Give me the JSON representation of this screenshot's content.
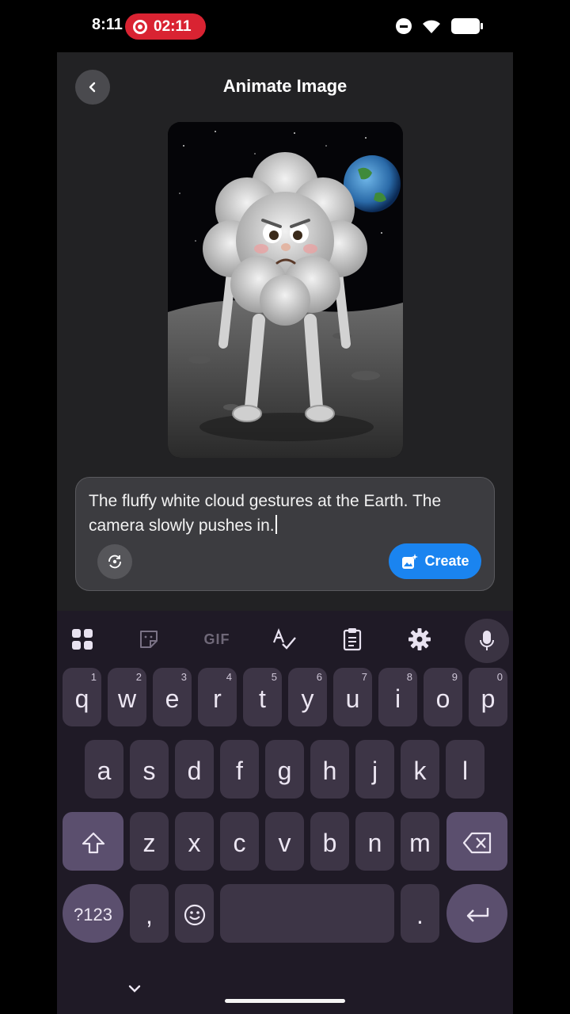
{
  "status_bar": {
    "time": "8:11",
    "recording_time": "02:11"
  },
  "header": {
    "title": "Animate Image"
  },
  "prompt": {
    "text": "The fluffy white cloud gestures at the Earth. The camera slowly pushes in.",
    "create_label": "Create"
  },
  "keyboard": {
    "toolbar": [
      "apps-grid-icon",
      "sticker-icon",
      "GIF",
      "spellcheck-icon",
      "clipboard-icon",
      "gear-icon",
      "microphone-icon"
    ],
    "gif_label": "GIF",
    "row1": [
      {
        "k": "q",
        "h": "1"
      },
      {
        "k": "w",
        "h": "2"
      },
      {
        "k": "e",
        "h": "3"
      },
      {
        "k": "r",
        "h": "4"
      },
      {
        "k": "t",
        "h": "5"
      },
      {
        "k": "y",
        "h": "6"
      },
      {
        "k": "u",
        "h": "7"
      },
      {
        "k": "i",
        "h": "8"
      },
      {
        "k": "o",
        "h": "9"
      },
      {
        "k": "p",
        "h": "0"
      }
    ],
    "row2": [
      "a",
      "s",
      "d",
      "f",
      "g",
      "h",
      "j",
      "k",
      "l"
    ],
    "row3": [
      "z",
      "x",
      "c",
      "v",
      "b",
      "n",
      "m"
    ],
    "symbols_label": "?123",
    "comma": ",",
    "period": "."
  },
  "colors": {
    "accent": "#1a84f0",
    "recording": "#d92332",
    "key": "#3d3546",
    "key_special": "#5b4f6e"
  }
}
